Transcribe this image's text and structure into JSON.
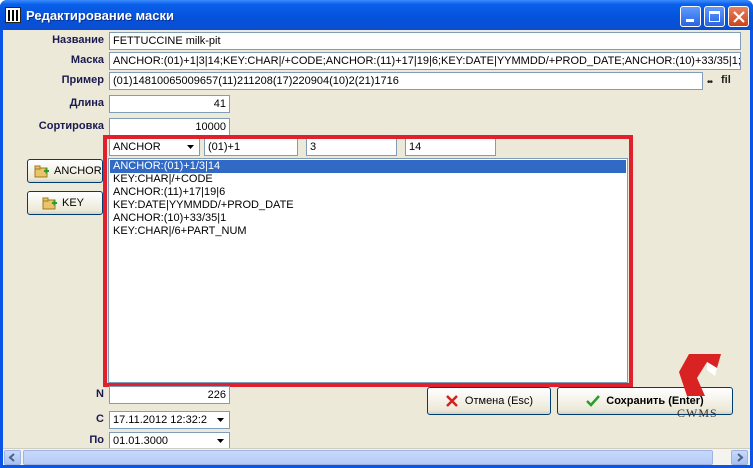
{
  "window": {
    "title": "Редактирование маски"
  },
  "form": {
    "name_label": "Название",
    "name_value": "FETTUCCINE milk-pit",
    "mask_label": "Маска",
    "mask_value": "ANCHOR:(01)+1|3|14;KEY:CHAR|/+CODE;ANCHOR:(11)+17|19|6;KEY:DATE|YYMMDD/+PROD_DATE;ANCHOR:(10)+33/35|1;KE",
    "example_label": "Пример",
    "example_value": "(01)14810065009657(11)211208(17)220904(10)2(21)1716",
    "example_suffix": "fil",
    "length_label": "Длина",
    "length_value": "41",
    "sort_label": "Сортировка",
    "sort_value": "10000",
    "n_label": "N",
    "n_value": "226",
    "from_label": "С",
    "from_value": "17.11.2012 12:32:2",
    "to_label": "По",
    "to_value": "01.01.3000"
  },
  "editor": {
    "type_select": "ANCHOR",
    "prefix_input": "(01)+1",
    "pos_input": "3",
    "len_input": "14",
    "items": [
      "ANCHOR:(01)+1/3|14",
      "KEY:CHAR|/+CODE",
      "ANCHOR:(11)+17|19|6",
      "KEY:DATE|YYMMDD/+PROD_DATE",
      "ANCHOR:(10)+33/35|1",
      "KEY:CHAR|/6+PART_NUM"
    ]
  },
  "buttons": {
    "anchor": "ANCHOR",
    "key": "KEY",
    "cancel": "Отмена (Esc)",
    "save": "Сохранить (Enter)"
  },
  "logo": {
    "text": "CWMS"
  }
}
